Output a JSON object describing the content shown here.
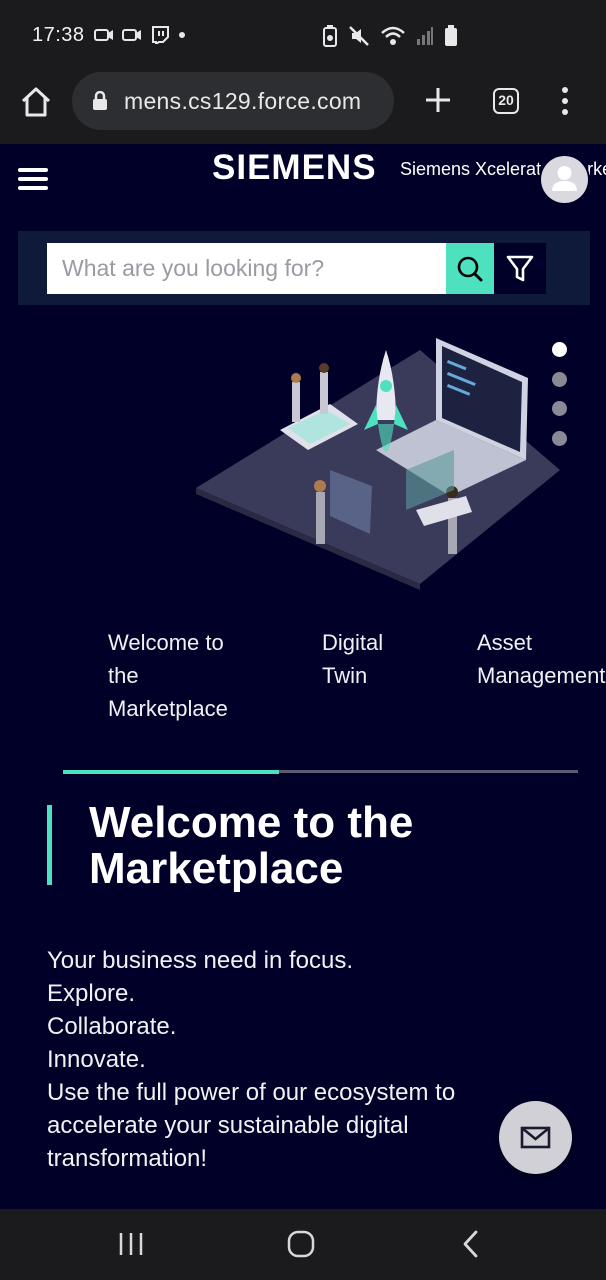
{
  "status_bar": {
    "time": "17:38",
    "left_icons": [
      "camera-icon",
      "camera-icon",
      "twitch-icon",
      "dot-icon"
    ],
    "right_icons": [
      "battery-saver-icon",
      "mute-icon",
      "wifi-icon",
      "signal-icon",
      "battery-icon"
    ]
  },
  "browser": {
    "url": "mens.cs129.force.com",
    "tab_count": "20"
  },
  "header": {
    "brand": "SIEMENS",
    "subtitle": "Siemens Xcelerator Marketplace"
  },
  "search": {
    "placeholder": "What are you looking for?"
  },
  "carousel": {
    "slide_count": 4,
    "active_index": 0,
    "progress_fraction": 0.42,
    "tabs": [
      {
        "label": "Welcome to\nthe\nMarketplace"
      },
      {
        "label": "Digital\nTwin"
      },
      {
        "label": "Asset\nManagement"
      }
    ]
  },
  "content": {
    "heading": "Welcome to the Marketplace",
    "lines": [
      "Your business need in focus.",
      "Explore.",
      "Collaborate.",
      "Innovate.",
      "Use the full power of our ecosystem to",
      "accelerate your sustainable digital",
      "transformation!"
    ]
  },
  "colors": {
    "background": "#000028",
    "accent": "#4ee1c0",
    "system_bar": "#1b1b1e"
  }
}
